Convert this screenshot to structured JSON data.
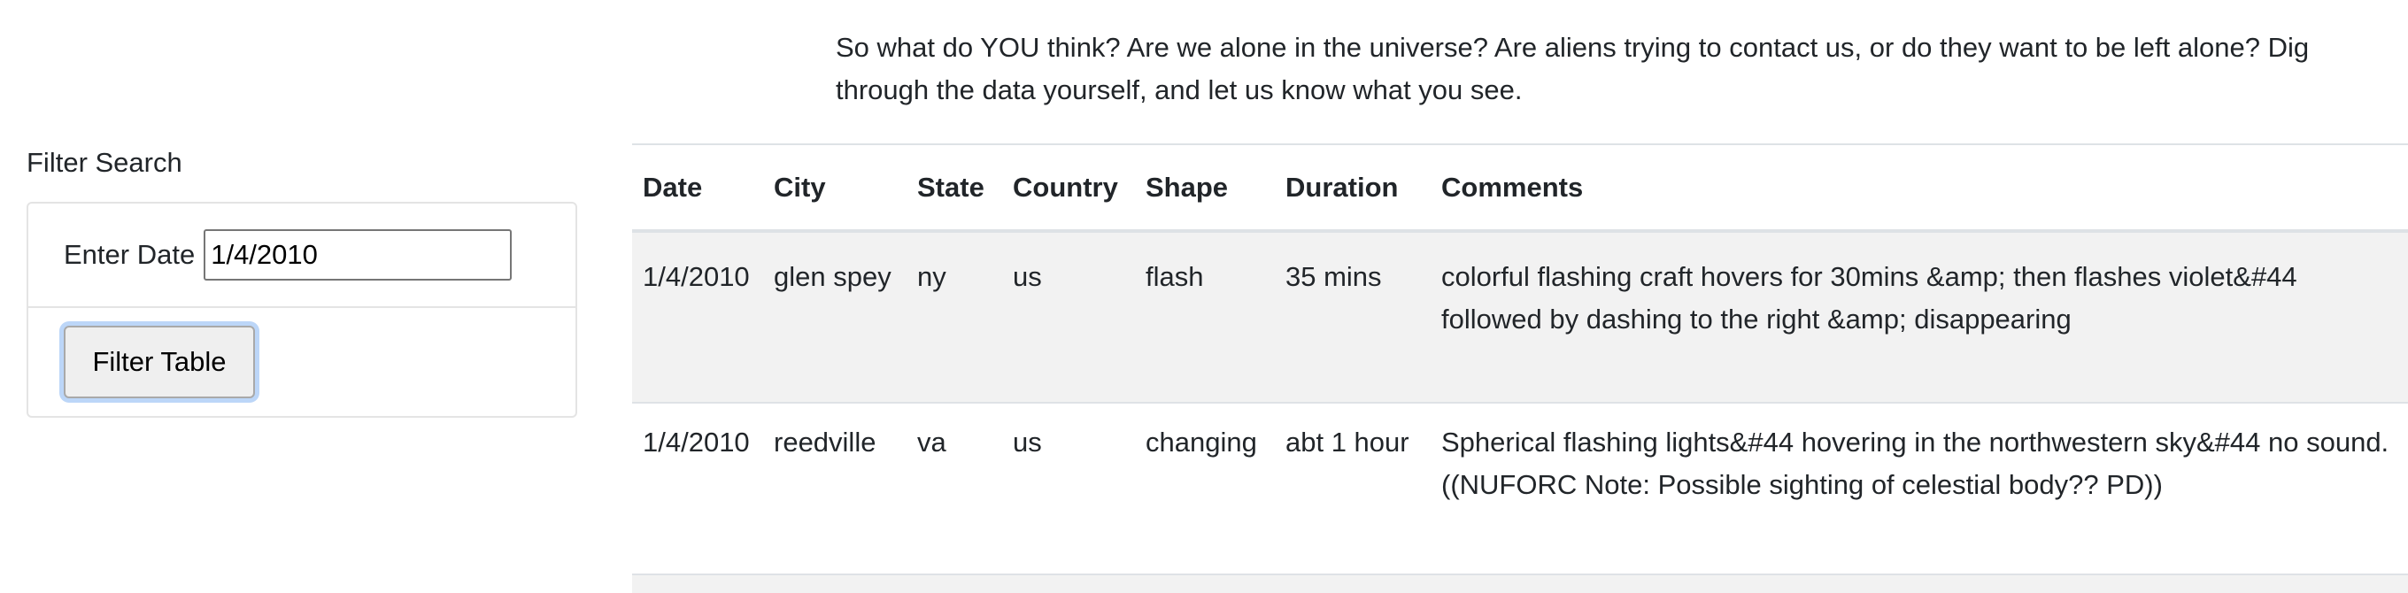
{
  "intro": {
    "text": "So what do YOU think? Are we alone in the universe? Are aliens trying to contact us, or do they want to be left alone? Dig through the data yourself, and let us know what you see."
  },
  "filter": {
    "heading": "Filter Search",
    "date_label": "Enter Date",
    "date_value": "1/4/2010",
    "button_label": "Filter Table"
  },
  "table": {
    "headers": [
      "Date",
      "City",
      "State",
      "Country",
      "Shape",
      "Duration",
      "Comments"
    ],
    "rows": [
      {
        "date": "1/4/2010",
        "city": "glen spey",
        "state": "ny",
        "country": "us",
        "shape": "flash",
        "duration": "35 mins",
        "comments": "colorful flashing craft hovers for 30mins &amp; then flashes violet&#44 followed by dashing to the right &amp; disappearing"
      },
      {
        "date": "1/4/2010",
        "city": "reedville",
        "state": "va",
        "country": "us",
        "shape": "changing",
        "duration": "abt 1 hour",
        "comments": "Spherical flashing lights&#44 hovering in the northwestern sky&#44 no sound. ((NUFORC Note: Possible sighting of celestial body?? PD))"
      }
    ]
  }
}
